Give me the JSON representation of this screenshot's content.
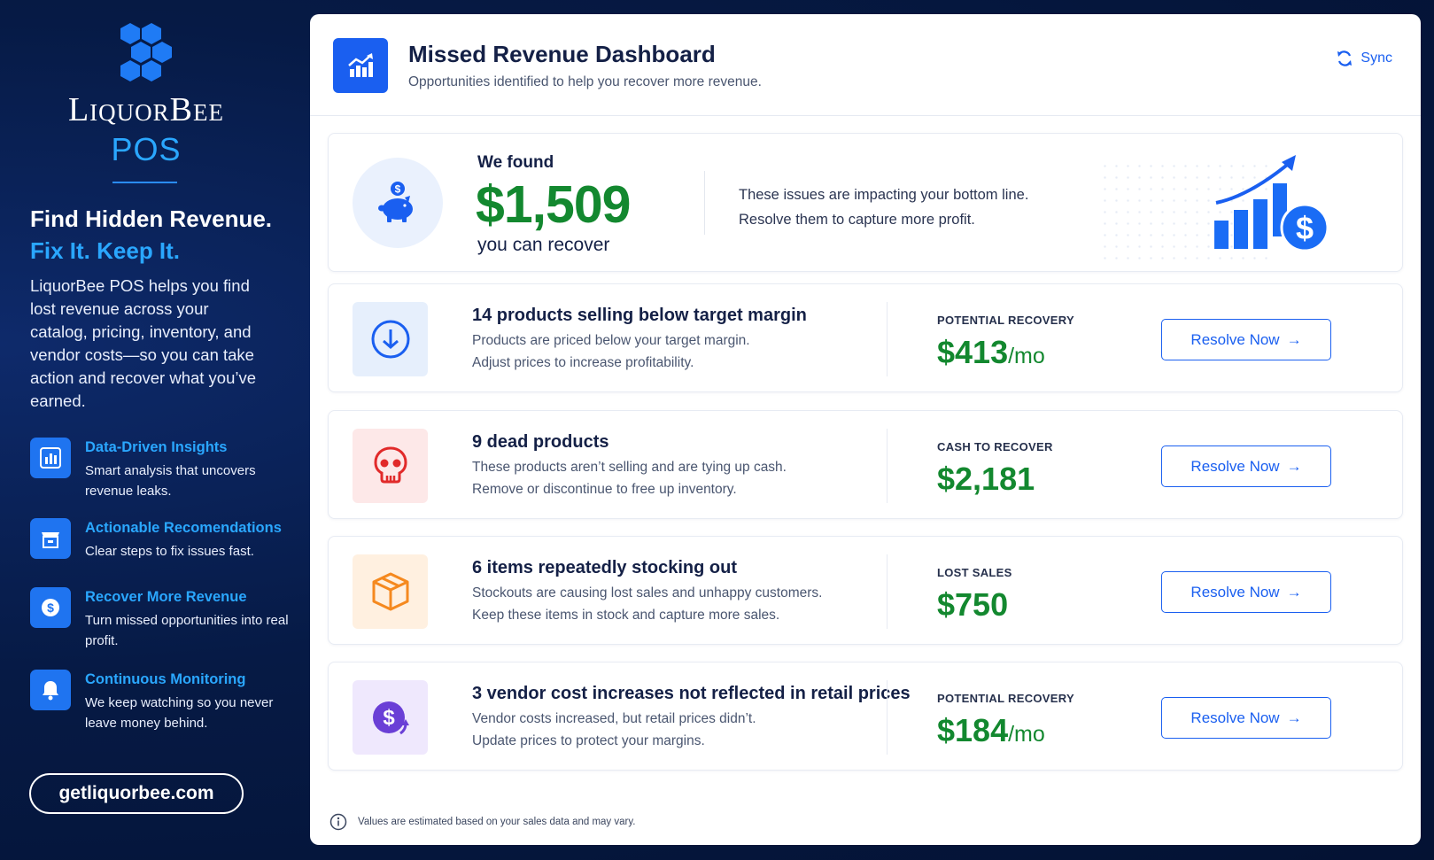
{
  "sidebar": {
    "brand": {
      "name": "LiquorBee",
      "product": "POS"
    },
    "hero": {
      "line1": "Find Hidden Revenue.",
      "line2": "Fix It. Keep It.",
      "description": "LiquorBee POS helps you find lost revenue across your catalog, pricing, inventory, and vendor costs—so you can take action and recover what you’ve earned."
    },
    "features": [
      {
        "icon": "bar-chart-icon",
        "title": "Data-Driven Insights",
        "desc": "Smart analysis that uncovers revenue leaks."
      },
      {
        "icon": "storefront-icon",
        "title": "Actionable Recomendations",
        "desc": "Clear steps to fix issues fast."
      },
      {
        "icon": "dollar-coin-icon",
        "title": "Recover More Revenue",
        "desc": "Turn missed opportunities into real profit."
      },
      {
        "icon": "bell-icon",
        "title": "Continuous Monitoring",
        "desc": "We keep watching so you never leave money behind."
      }
    ],
    "website": "getliquorbee.com"
  },
  "header": {
    "title": "Missed Revenue Dashboard",
    "subtitle": "Opportunities identified to help you recover more revenue.",
    "sync_label": "Sync"
  },
  "summary": {
    "label": "We found",
    "amount": "$1,509",
    "suffix": "you can recover",
    "message_line1": "These issues are impacting your bottom line.",
    "message_line2": "Resolve them to capture more profit."
  },
  "issues": [
    {
      "icon": "arrow-down-circle-icon",
      "title": "14 products selling below target margin",
      "desc1": "Products are priced below your target margin.",
      "desc2": "Adjust prices to increase profitability.",
      "metric_label": "POTENTIAL RECOVERY",
      "metric_value": "$413",
      "metric_unit": "/mo",
      "button": "Resolve Now"
    },
    {
      "icon": "skull-icon",
      "title": "9 dead products",
      "desc1": "These products aren’t selling and are tying up cash.",
      "desc2": "Remove or discontinue to free up inventory.",
      "metric_label": "CASH TO RECOVER",
      "metric_value": "$2,181",
      "metric_unit": "",
      "button": "Resolve Now"
    },
    {
      "icon": "box-icon",
      "title": "6 items repeatedly stocking out",
      "desc1": "Stockouts are causing lost sales and unhappy customers.",
      "desc2": "Keep these items in stock and capture more sales.",
      "metric_label": "LOST SALES",
      "metric_value": "$750",
      "metric_unit": "",
      "button": "Resolve Now"
    },
    {
      "icon": "dollar-up-icon",
      "title": "3 vendor cost increases not reflected in retail prices",
      "desc1": "Vendor costs increased, but retail prices didn’t.",
      "desc2": "Update prices to protect your margins.",
      "metric_label": "POTENTIAL RECOVERY",
      "metric_value": "$184",
      "metric_unit": "/mo",
      "button": "Resolve Now"
    }
  ],
  "footer_note": "Values are estimated based on your sales data and may vary.",
  "colors": {
    "accent": "#1a5ff0",
    "brand_blue": "#2aa7ff",
    "money_green": "#13882f",
    "sidebar_bg": "#061a45"
  }
}
